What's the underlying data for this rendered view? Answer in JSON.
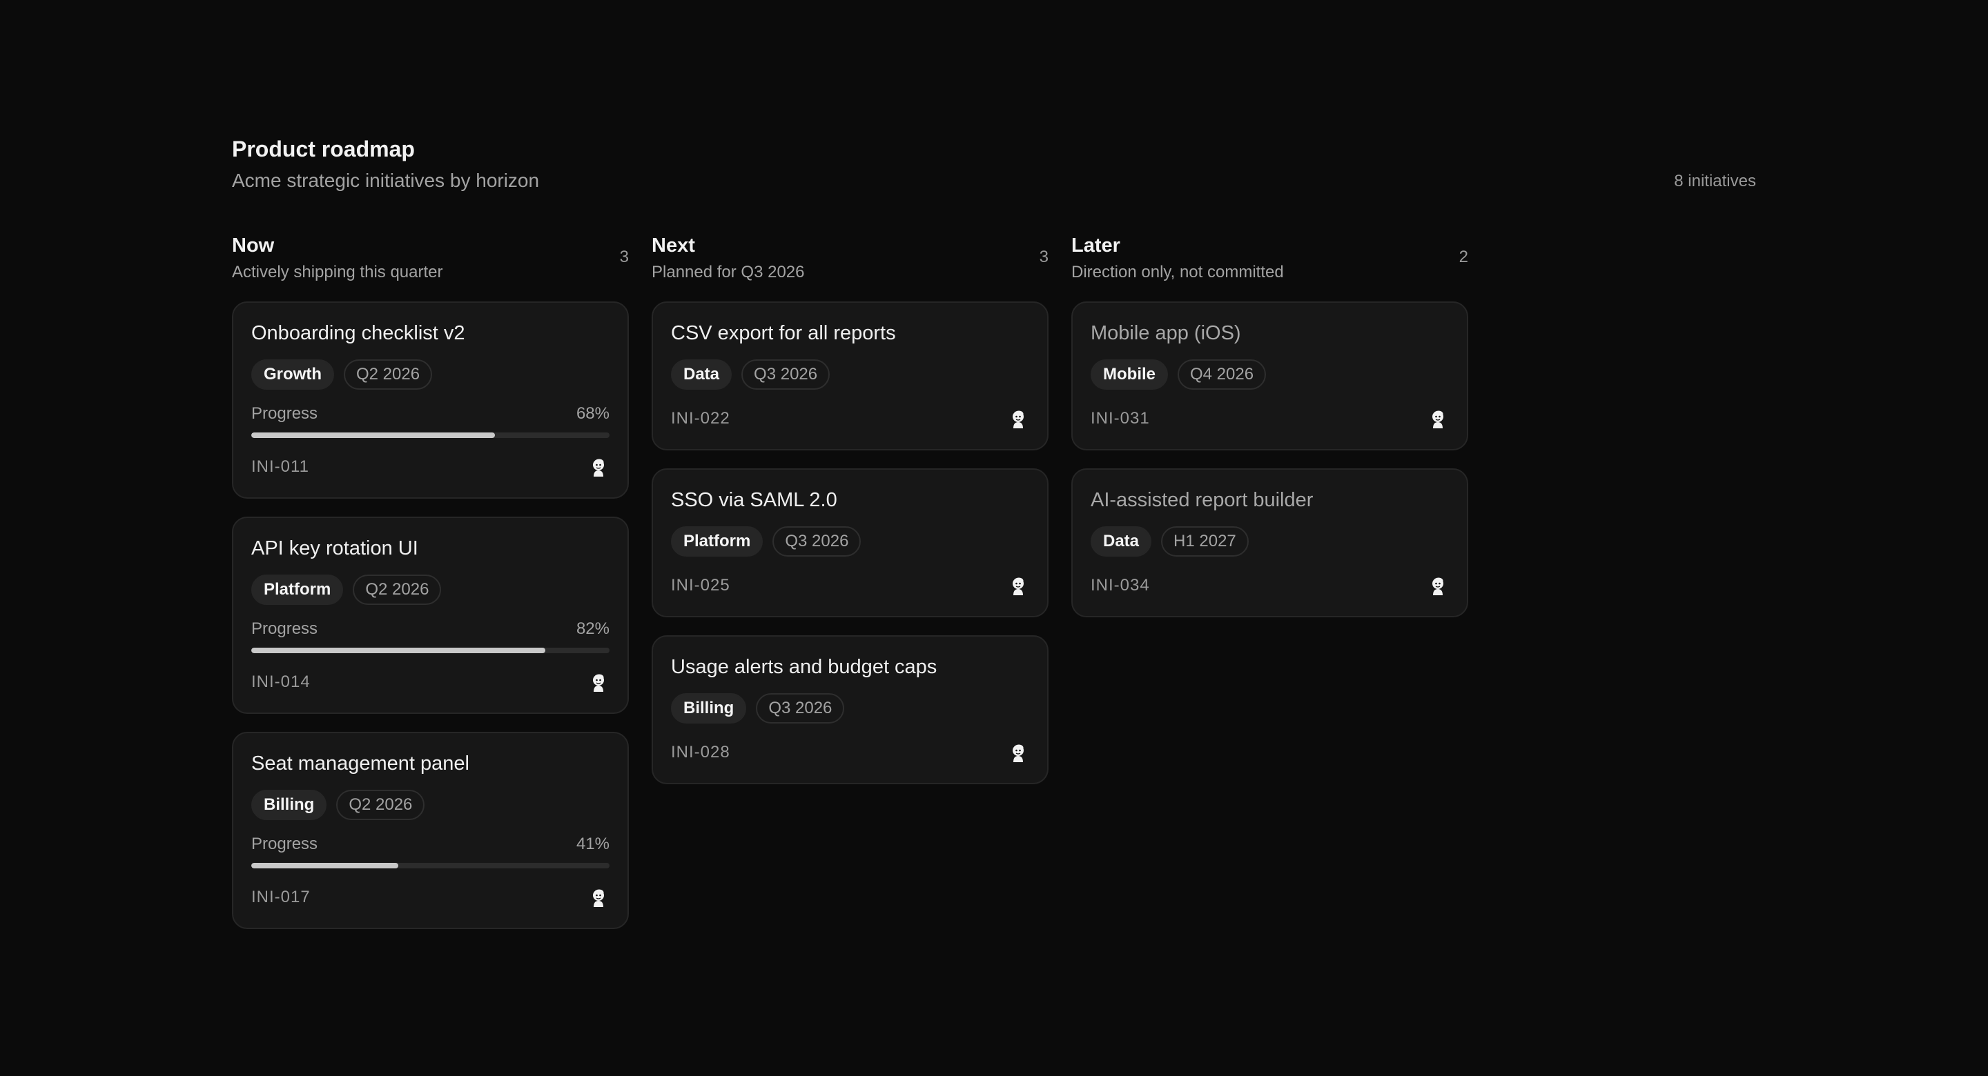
{
  "header": {
    "title": "Product roadmap",
    "subtitle": "Acme strategic initiatives by horizon",
    "total": "8 initiatives"
  },
  "columns": [
    {
      "name": "Now",
      "description": "Actively shipping this quarter",
      "count": "3",
      "cards": [
        {
          "title": "Onboarding checklist v2",
          "team": "Growth",
          "quarter": "Q2 2026",
          "progress_label": "Progress",
          "progress": "68%",
          "progress_value": 0.68,
          "id": "INI-011"
        },
        {
          "title": "API key rotation UI",
          "team": "Platform",
          "quarter": "Q2 2026",
          "progress_label": "Progress",
          "progress": "82%",
          "progress_value": 0.82,
          "id": "INI-014"
        },
        {
          "title": "Seat management panel",
          "team": "Billing",
          "quarter": "Q2 2026",
          "progress_label": "Progress",
          "progress": "41%",
          "progress_value": 0.41,
          "id": "INI-017"
        }
      ]
    },
    {
      "name": "Next",
      "description": "Planned for Q3 2026",
      "count": "3",
      "cards": [
        {
          "title": "CSV export for all reports",
          "team": "Data",
          "quarter": "Q3 2026",
          "id": "INI-022"
        },
        {
          "title": "SSO via SAML 2.0",
          "team": "Platform",
          "quarter": "Q3 2026",
          "id": "INI-025"
        },
        {
          "title": "Usage alerts and budget caps",
          "team": "Billing",
          "quarter": "Q3 2026",
          "id": "INI-028"
        }
      ]
    },
    {
      "name": "Later",
      "description": "Direction only, not committed",
      "count": "2",
      "cards": [
        {
          "title": "Mobile app (iOS)",
          "team": "Mobile",
          "quarter": "Q4 2026",
          "id": "INI-031"
        },
        {
          "title": "AI-assisted report builder",
          "team": "Data",
          "quarter": "H1 2027",
          "id": "INI-034"
        }
      ]
    }
  ],
  "icons": {
    "owner_avatar": "owner-avatar-icon"
  },
  "colors": {
    "background": "#0b0b0b",
    "card": "#171717",
    "progress_fill": "#c9c9c9"
  }
}
